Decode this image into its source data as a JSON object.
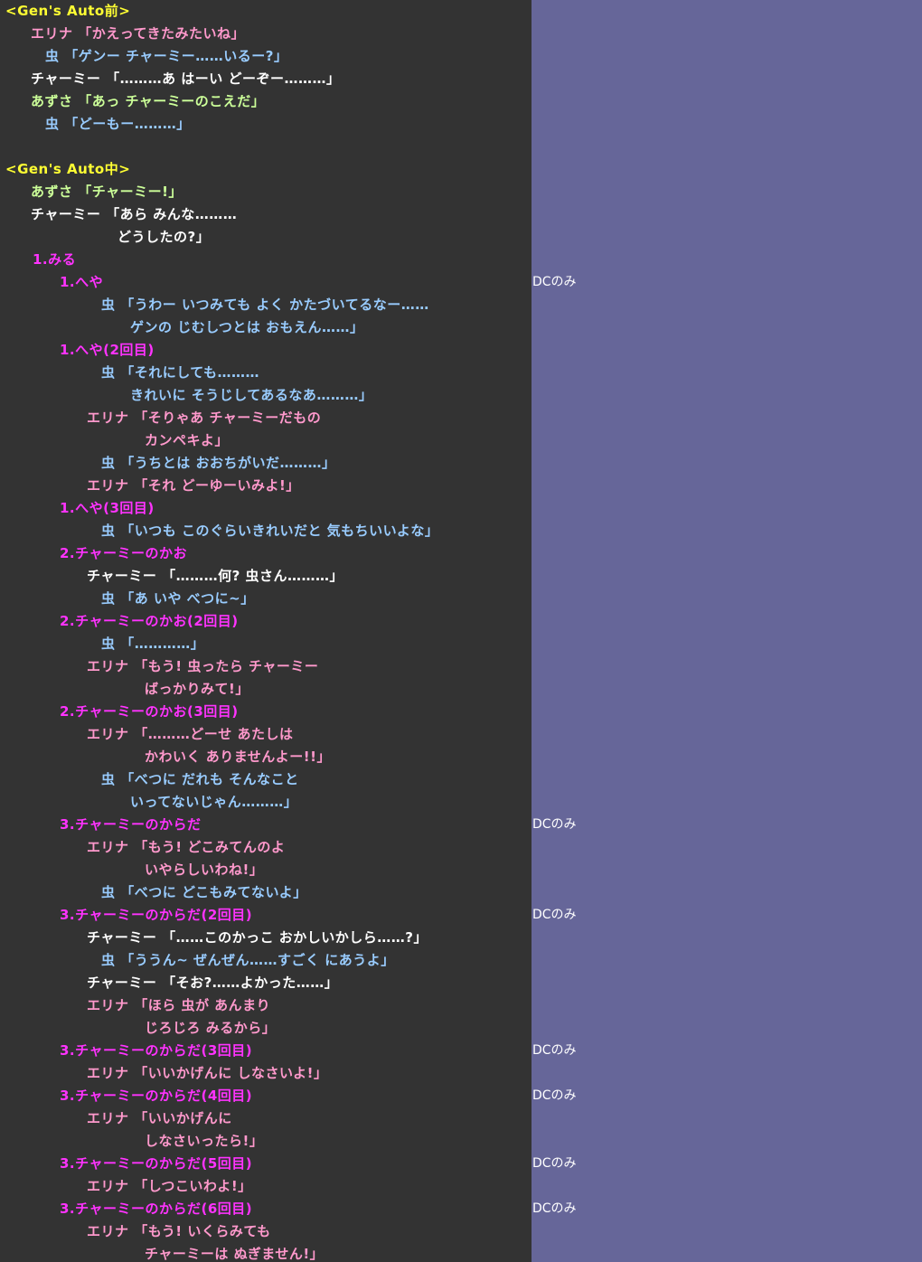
{
  "colors": {
    "background": "#333333",
    "side_panel": "#666699",
    "section_header": "#ffff33",
    "erina": "#ff99cc",
    "mushi": "#99ccff",
    "charmy": "#ffffff",
    "azusa": "#ccff99",
    "choice": "#ff33ff"
  },
  "lines": [
    {
      "text": "<Gen's Auto前>"
    },
    {
      "text": "エリナ 「かえってきたみたいね」"
    },
    {
      "text": "虫 「ゲンー チャーミー……いるー?」"
    },
    {
      "text": "チャーミー 「………あ はーい どーぞー………」"
    },
    {
      "text": "あずさ 「あっ チャーミーのこえだ」"
    },
    {
      "text": "虫 「どーもー………」"
    },
    {
      "text": "<Gen's Auto中>"
    },
    {
      "text": "あずさ 「チャーミー!」"
    },
    {
      "text": "チャーミー 「あら みんな………"
    },
    {
      "text": "どうしたの?」"
    },
    {
      "text": "1.みる"
    },
    {
      "text": "1.へや"
    },
    {
      "text": "虫 「うわー いつみても よく かたづいてるなー……"
    },
    {
      "text": "ゲンの じむしつとは おもえん……」"
    },
    {
      "text": "1.へや(2回目)"
    },
    {
      "text": "虫 「それにしても………"
    },
    {
      "text": "きれいに そうじしてあるなあ………」"
    },
    {
      "text": "エリナ 「そりゃあ チャーミーだもの"
    },
    {
      "text": "カンペキよ」"
    },
    {
      "text": "虫 「うちとは おおちがいだ………」"
    },
    {
      "text": "エリナ 「それ どーゆーいみよ!」"
    },
    {
      "text": "1.へや(3回目)"
    },
    {
      "text": "虫 「いつも このぐらいきれいだと 気もちいいよな」"
    },
    {
      "text": "2.チャーミーのかお"
    },
    {
      "text": "チャーミー 「………何? 虫さん………」"
    },
    {
      "text": "虫 「あ いや べつに~」"
    },
    {
      "text": "2.チャーミーのかお(2回目)"
    },
    {
      "text": "虫 「…………」"
    },
    {
      "text": "エリナ 「もう! 虫ったら チャーミー"
    },
    {
      "text": "ばっかりみて!」"
    },
    {
      "text": "2.チャーミーのかお(3回目)"
    },
    {
      "text": "エリナ 「………どーせ あたしは"
    },
    {
      "text": "かわいく ありませんよー!!」"
    },
    {
      "text": "虫 「べつに だれも そんなこと"
    },
    {
      "text": "いってないじゃん………」"
    },
    {
      "text": "3.チャーミーのからだ"
    },
    {
      "text": "エリナ 「もう! どこみてんのよ"
    },
    {
      "text": "いやらしいわね!」"
    },
    {
      "text": "虫 「べつに どこもみてないよ」"
    },
    {
      "text": "3.チャーミーのからだ(2回目)"
    },
    {
      "text": "チャーミー 「……このかっこ おかしいかしら……?」"
    },
    {
      "text": "虫 「ううん~ ぜんぜん……すごく にあうよ」"
    },
    {
      "text": "チャーミー 「そお?……よかった……」"
    },
    {
      "text": "エリナ 「ほら 虫が あんまり"
    },
    {
      "text": "じろじろ みるから」"
    },
    {
      "text": "3.チャーミーのからだ(3回目)"
    },
    {
      "text": "エリナ 「いいかげんに しなさいよ!」"
    },
    {
      "text": "3.チャーミーのからだ(4回目)"
    },
    {
      "text": "エリナ 「いいかげんに"
    },
    {
      "text": "しなさいったら!」"
    },
    {
      "text": "3.チャーミーのからだ(5回目)"
    },
    {
      "text": "エリナ 「しつこいわよ!」"
    },
    {
      "text": "3.チャーミーのからだ(6回目)"
    },
    {
      "text": "エリナ 「もう! いくらみても"
    },
    {
      "text": "チャーミーは ぬぎません!」"
    }
  ],
  "notes": [
    "DCのみ",
    "DCのみ",
    "DCのみ",
    "DCのみ",
    "DCのみ",
    "DCのみ",
    "DCのみ"
  ]
}
